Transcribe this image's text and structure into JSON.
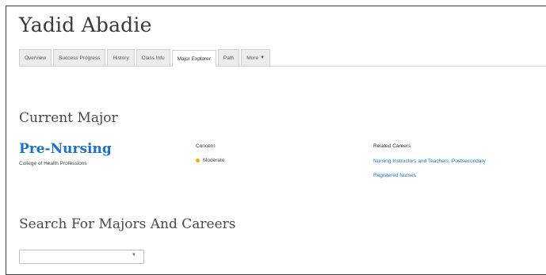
{
  "student": {
    "name": "Yadid Abadie"
  },
  "tabs": [
    {
      "label": "Overview",
      "active": false
    },
    {
      "label": "Success Progress",
      "active": false
    },
    {
      "label": "History",
      "active": false
    },
    {
      "label": "Class Info",
      "active": false
    },
    {
      "label": "Major Explorer",
      "active": true
    },
    {
      "label": "Path",
      "active": false
    },
    {
      "label": "More",
      "active": false
    }
  ],
  "more_caret_icon": "caret-down-icon",
  "current_major": {
    "section_title": "Current Major",
    "major_name": "Pre-Nursing",
    "college": "College of Health Professions",
    "concern_label": "Concern",
    "concern_value": "Moderate",
    "concern_color": "#f0b400",
    "related_careers_label": "Related Careers",
    "related_careers": [
      "Nursing Instructors and Teachers, Postsecondary",
      "Registered Nurses"
    ]
  },
  "search": {
    "section_title": "Search For Majors And Careers",
    "select_value": ""
  },
  "colors": {
    "link": "#1f6fc5",
    "heading": "#4a4a4a",
    "name": "#3a3a3a"
  }
}
